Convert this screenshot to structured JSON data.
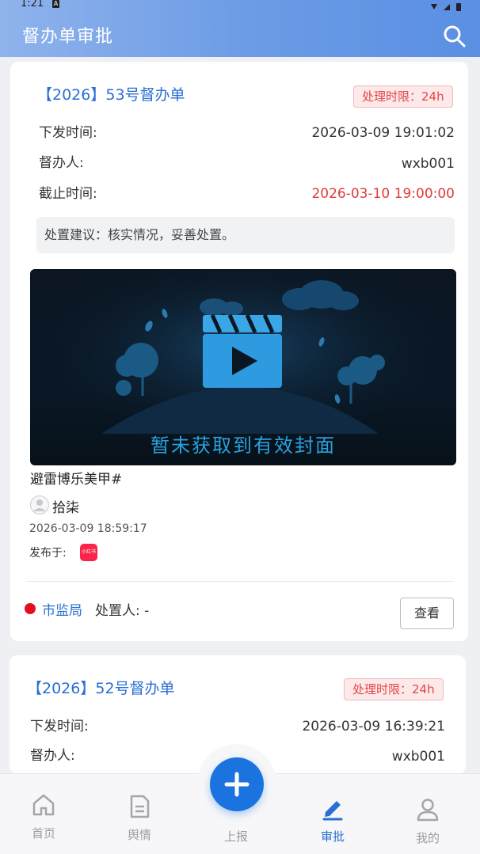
{
  "status_bar": {
    "time": "1:21",
    "notif": "A"
  },
  "header": {
    "title": "督办单审批"
  },
  "cards": [
    {
      "title": "【2026】53号督办单",
      "deadline_badge": "处理时限：24h",
      "issue_time_label": "下发时间:",
      "issue_time": "2026-03-09 19:01:02",
      "supervisor_label": "督办人:",
      "supervisor": "wxb001",
      "due_label": "截止时间:",
      "due": "2026-03-10 19:00:00",
      "suggestion": "处置建议：核实情况，妥善处置。",
      "cover_text": "暂未获取到有效封面",
      "post_title": "避雷博乐美甲#",
      "author": "拾柒",
      "post_time": "2026-03-09 18:59:17",
      "publish_label": "发布于:",
      "platform": "小红书",
      "dept": "市监局",
      "handler": "处置人: -",
      "view_button": "查看"
    },
    {
      "title": "【2026】52号督办单",
      "deadline_badge": "处理时限：24h",
      "issue_time_label": "下发时间:",
      "issue_time": "2026-03-09 16:39:21",
      "supervisor_label": "督办人:",
      "supervisor": "wxb001"
    }
  ],
  "tabbar": {
    "items": [
      {
        "label": "首页",
        "icon": "home-icon"
      },
      {
        "label": "舆情",
        "icon": "document-icon"
      },
      {
        "label": "上报",
        "icon": "plus-icon"
      },
      {
        "label": "审批",
        "icon": "pen-icon",
        "active": true
      },
      {
        "label": "我的",
        "icon": "user-icon"
      }
    ]
  },
  "colors": {
    "accent": "#2a6fd3",
    "danger": "#e03b3b",
    "fab": "#1a73de"
  }
}
